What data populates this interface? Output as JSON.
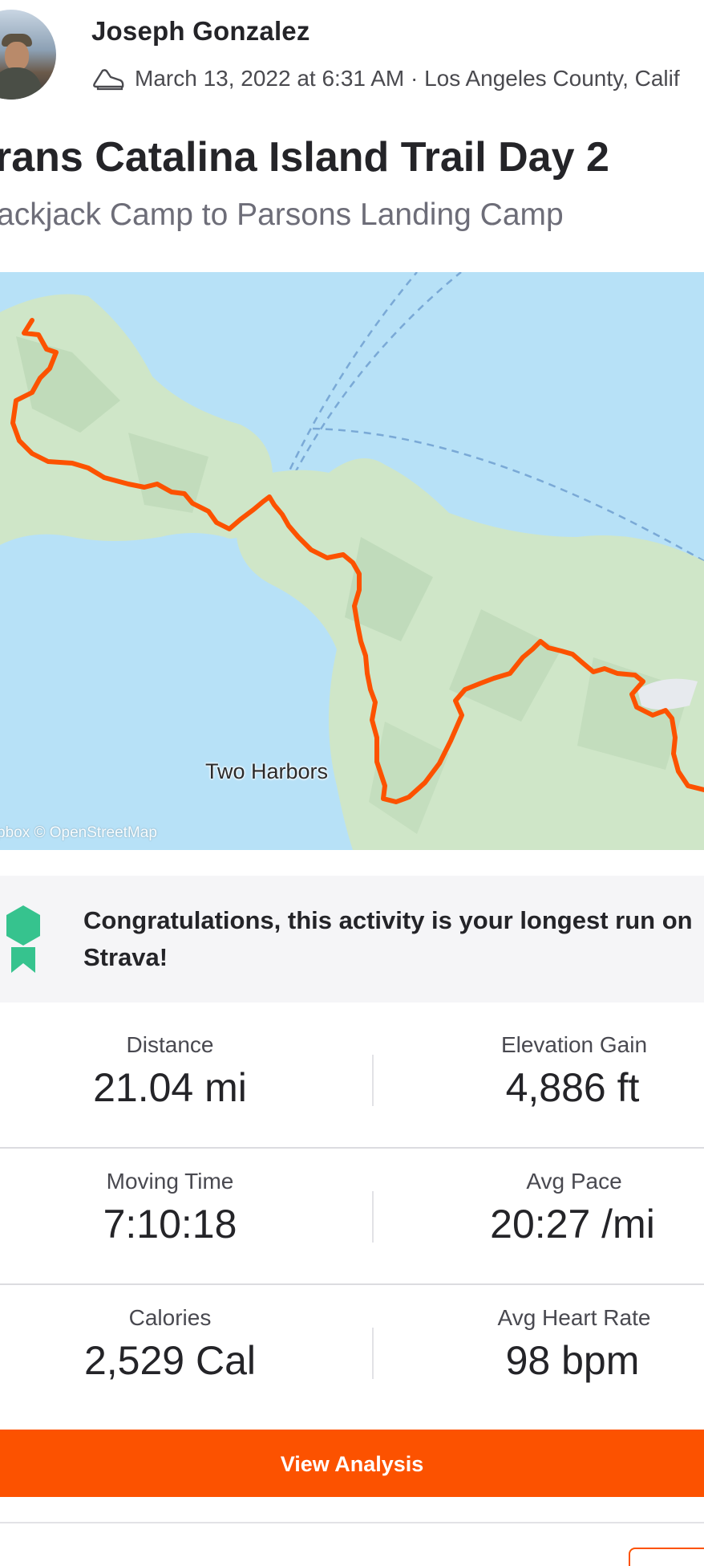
{
  "athlete": {
    "name": "Joseph Gonzalez",
    "avatar": "avatar-photo"
  },
  "activity": {
    "type_icon": "shoe-icon",
    "meta": "March 13, 2022 at 6:31 AM · Los Angeles County, Calif",
    "title": "rans Catalina Island Trail Day 2",
    "subtitle": "ackjack Camp to Parsons Landing Camp"
  },
  "map": {
    "place_label": "Two Harbors",
    "attribution": "pbox © OpenStreetMap",
    "route_color": "#fc5200",
    "water_color": "#b7e1f7",
    "land_color": "#cfe6c8"
  },
  "achievement": {
    "icon": "medal-icon",
    "text": "Congratulations, this activity is your longest run on Strava!",
    "icon_color": "#36c38e"
  },
  "stats": [
    {
      "label": "Distance",
      "value": "21.04 mi"
    },
    {
      "label": "Elevation Gain",
      "value": "4,886 ft"
    },
    {
      "label": "Moving Time",
      "value": "7:10:18"
    },
    {
      "label": "Avg Pace",
      "value": "20:27 /mi"
    },
    {
      "label": "Calories",
      "value": "2,529 Cal"
    },
    {
      "label": "Avg Heart Rate",
      "value": "98 bpm"
    }
  ],
  "actions": {
    "view_analysis": "View Analysis"
  },
  "colors": {
    "brand": "#fc5200",
    "text": "#242428"
  }
}
